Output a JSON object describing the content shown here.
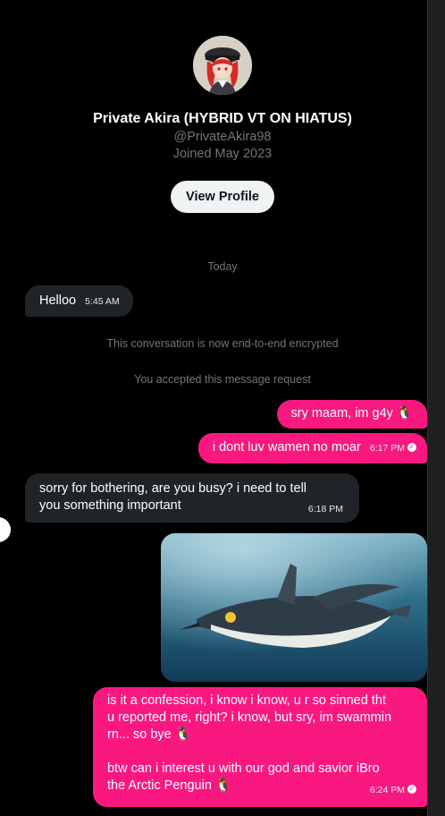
{
  "profile": {
    "name": "Private Akira (HYBRID VT ON HIATUS)",
    "handle": "@PrivateAkira98",
    "joined": "Joined May 2023",
    "view_profile_label": "View Profile"
  },
  "conversation": {
    "day_label": "Today",
    "system_encrypted": "This conversation is now end-to-end encrypted",
    "system_accepted": "You accepted this message request",
    "messages": [
      {
        "direction": "in",
        "text": "Helloo",
        "time": "5:45 AM"
      },
      {
        "direction": "out",
        "text": "sry maam, im g4y 🐧",
        "time": ""
      },
      {
        "direction": "out",
        "text": "i dont luv wamen no moar",
        "time": "6:17 PM"
      },
      {
        "direction": "in",
        "line1": "sorry for bothering, are you busy? i need to tell",
        "line2": "you something important",
        "time": "6:18 PM"
      },
      {
        "direction": "out",
        "type": "image",
        "image_icon": "penguin-swimming-photo"
      },
      {
        "direction": "out",
        "line1": "is it a confession, i know i know, u r so sinned tht",
        "line2": "u reported me, right? i know, but sry, im swammin",
        "line3": "rn... so bye 🐧",
        "line4": "btw can i interest u with our god and savior iBro",
        "line5": "the Arctic Penguin 🐧",
        "time": "6:24 PM"
      }
    ]
  },
  "colors": {
    "background": "#000000",
    "outgoing_bubble": "#f91880",
    "incoming_bubble": "#202327",
    "muted_text": "#71767b"
  }
}
